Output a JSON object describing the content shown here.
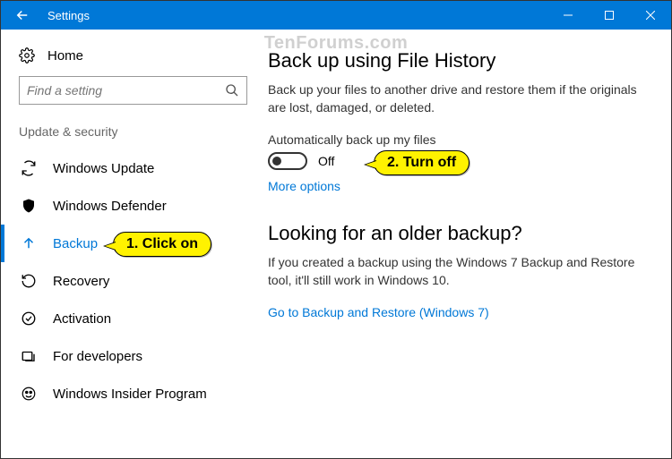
{
  "titlebar": {
    "title": "Settings"
  },
  "watermark": "TenForums.com",
  "sidebar": {
    "home": "Home",
    "search_placeholder": "Find a setting",
    "category": "Update & security",
    "items": [
      {
        "label": "Windows Update"
      },
      {
        "label": "Windows Defender"
      },
      {
        "label": "Backup"
      },
      {
        "label": "Recovery"
      },
      {
        "label": "Activation"
      },
      {
        "label": "For developers"
      },
      {
        "label": "Windows Insider Program"
      }
    ]
  },
  "main": {
    "h1": "Back up using File History",
    "desc": "Back up your files to another drive and restore them if the originals are lost, damaged, or deleted.",
    "toggle_label": "Automatically back up my files",
    "toggle_state": "Off",
    "more_options": "More options",
    "h2": "Looking for an older backup?",
    "desc2": "If you created a backup using the Windows 7 Backup and Restore tool, it'll still work in Windows 10.",
    "link2": "Go to Backup and Restore (Windows 7)"
  },
  "callouts": {
    "c1": "1. Click on",
    "c2": "2. Turn off"
  }
}
